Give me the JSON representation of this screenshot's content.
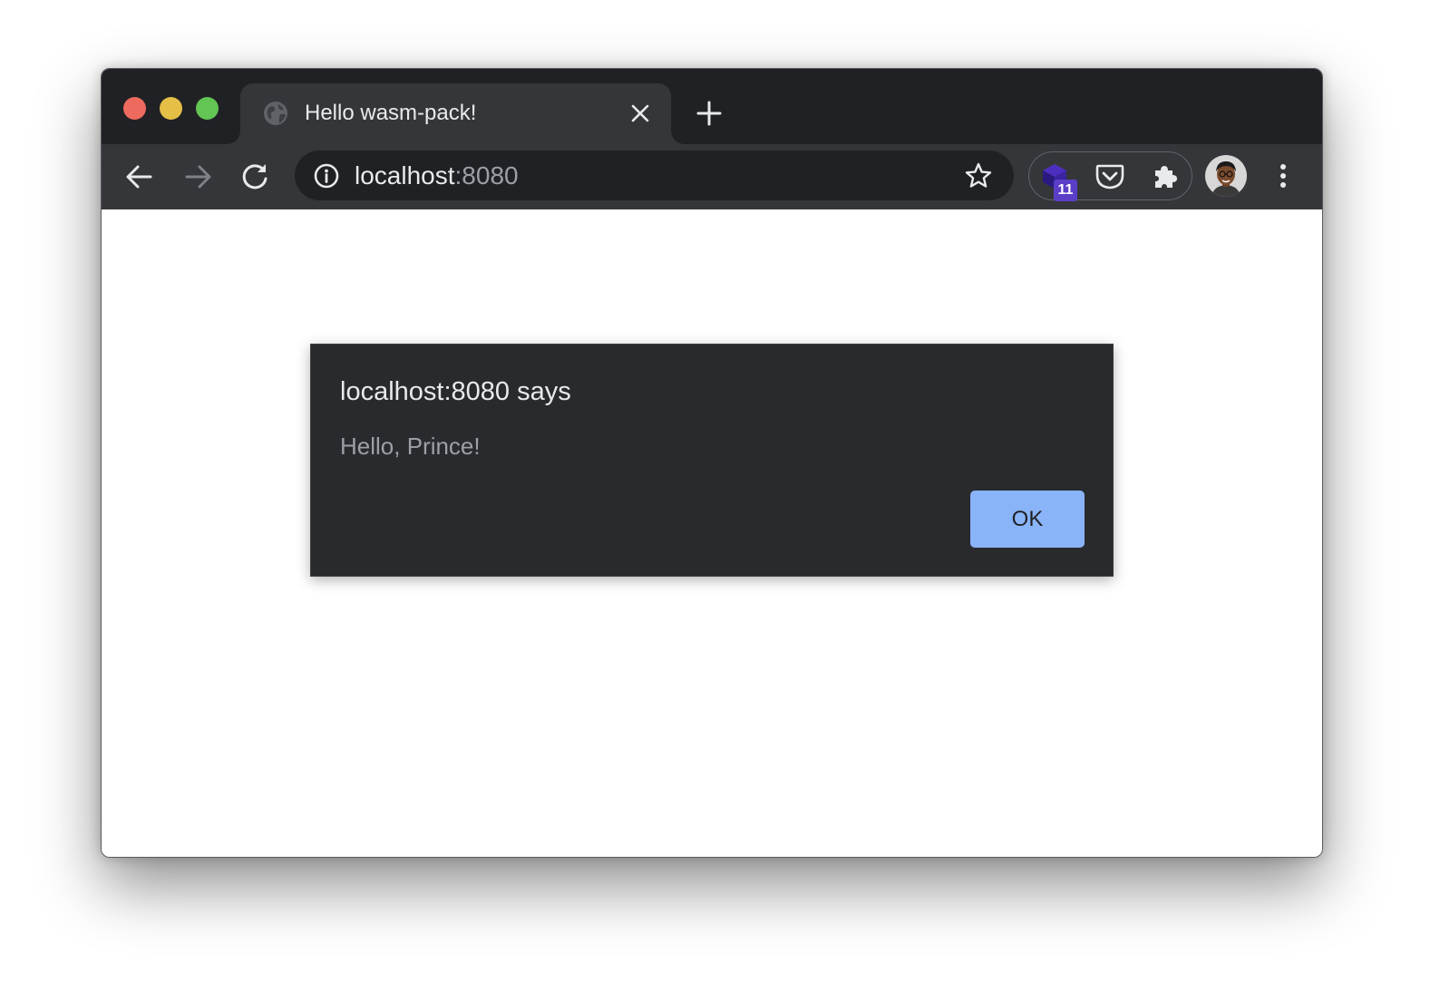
{
  "window": {
    "traffic_lights": {
      "close_color": "#ed6a5e",
      "minimize_color": "#e6bf47",
      "maximize_color": "#62c554"
    }
  },
  "tab": {
    "title": "Hello wasm-pack!",
    "favicon": "globe-icon"
  },
  "toolbar": {
    "back_icon": "arrow-left-icon",
    "forward_icon": "arrow-right-icon",
    "reload_icon": "reload-icon",
    "forward_enabled": false
  },
  "omnibox": {
    "host": "localhost",
    "port": ":8080",
    "site_info_icon": "info-icon",
    "bookmark_icon": "star-icon"
  },
  "extensions": {
    "items": [
      "cube-extension-icon",
      "pocket-icon",
      "puzzle-icon"
    ],
    "badge": "11",
    "badge_color": "#5b3ec8"
  },
  "dialog": {
    "title": "localhost:8080 says",
    "message": "Hello, Prince!",
    "ok_label": "OK"
  },
  "colors": {
    "titlebar": "#202124",
    "toolbar": "#35363a",
    "dialog_bg": "#292a2d",
    "primary_button": "#8ab4f8"
  }
}
